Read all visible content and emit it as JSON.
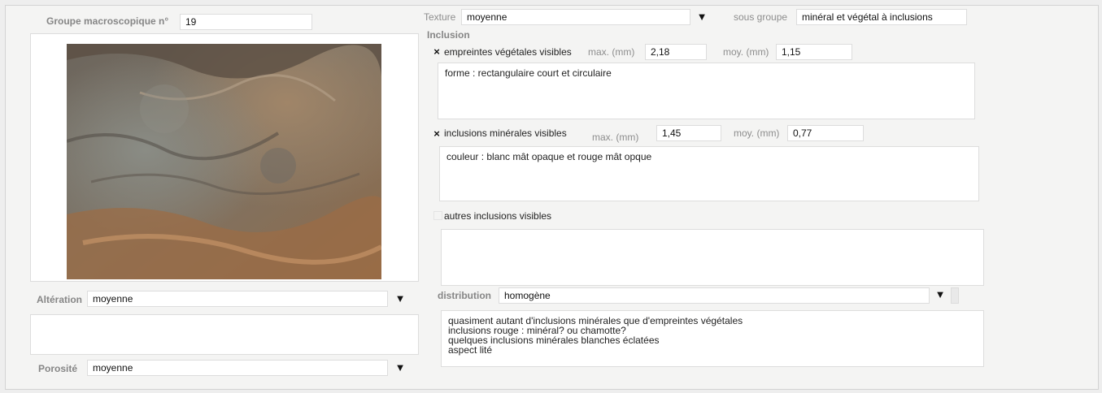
{
  "groupe": {
    "label": "Groupe macroscopique n°",
    "value": "19"
  },
  "texture": {
    "label": "Texture",
    "value": "moyenne"
  },
  "sous_groupe": {
    "label": "sous groupe",
    "value": "minéral et végétal à inclusions"
  },
  "inclusion": {
    "heading": "Inclusion",
    "vegetales": {
      "check": "×",
      "label": "empreintes végétales visibles",
      "max_label": "max. (mm)",
      "max": "2,18",
      "moy_label": "moy. (mm)",
      "moy": "1,15",
      "note": "forme : rectangulaire court et circulaire"
    },
    "minerales": {
      "check": "×",
      "label": "inclusions minérales visibles",
      "max_label": "max. (mm)",
      "max": "1,45",
      "moy_label": "moy. (mm)",
      "moy": "0,77",
      "note": "couleur : blanc mât opaque et rouge mât opque"
    },
    "autres": {
      "label": "autres inclusions visibles",
      "note": ""
    }
  },
  "distribution": {
    "label": "distribution",
    "value": "homogène",
    "note": "quasiment autant d'inclusions minérales que d'empreintes végétales\ninclusions rouge : minéral? ou chamotte?\nquelques inclusions minérales blanches éclatées\naspect lité"
  },
  "alteration": {
    "label": "Altération",
    "value": "moyenne",
    "note": ""
  },
  "porosite": {
    "label": "Porosité",
    "value": "moyenne"
  },
  "icons": {
    "dropdown": "▼"
  },
  "colors": {
    "panel": "#f4f4f3",
    "field": "#ffffff",
    "label": "#8d8d8d"
  }
}
